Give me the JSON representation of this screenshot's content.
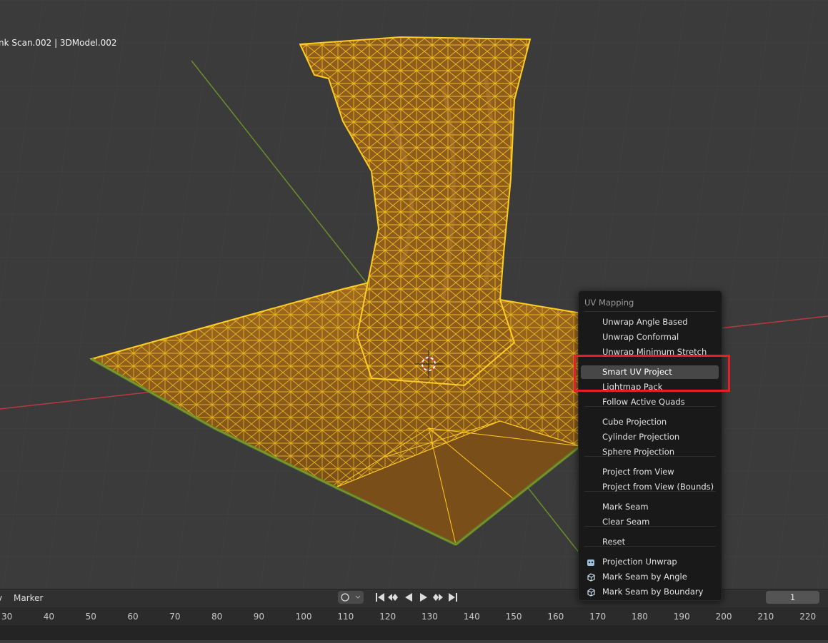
{
  "viewport": {
    "object_label": "nk Scan.002 | 3DModel.002"
  },
  "menu": {
    "title": "UV Mapping",
    "items": [
      {
        "label": "Unwrap Angle Based"
      },
      {
        "label": "Unwrap Conformal"
      },
      {
        "label": "Unwrap Minimum Stretch"
      },
      {
        "label": "Smart UV Project",
        "active": true
      },
      {
        "label": "Lightmap Pack"
      },
      {
        "label": "Follow Active Quads"
      },
      {
        "label": "Cube Projection"
      },
      {
        "label": "Cylinder Projection"
      },
      {
        "label": "Sphere Projection"
      },
      {
        "label": "Project from View"
      },
      {
        "label": "Project from View (Bounds)"
      },
      {
        "label": "Mark Seam"
      },
      {
        "label": "Clear Seam"
      },
      {
        "label": "Reset"
      },
      {
        "label": "Projection Unwrap",
        "icon": "addon-icon"
      },
      {
        "label": "Mark Seam by Angle",
        "icon": "cube-icon"
      },
      {
        "label": "Mark Seam by Boundary",
        "icon": "cube-icon"
      }
    ]
  },
  "timeline": {
    "view_menu": "v",
    "marker_menu": "Marker",
    "current_frame": "1",
    "ruler_labels": [
      "30",
      "40",
      "50",
      "60",
      "70",
      "80",
      "90",
      "100",
      "110",
      "120",
      "130",
      "140",
      "150",
      "160",
      "170",
      "180",
      "190",
      "200",
      "210",
      "220"
    ]
  },
  "colors": {
    "mesh_face": "#8a5a1c",
    "mesh_wire": "#ffcc22",
    "highlight_box": "#e3202a",
    "x_axis": "#b8393f",
    "y_axis": "#6a8f2a"
  }
}
